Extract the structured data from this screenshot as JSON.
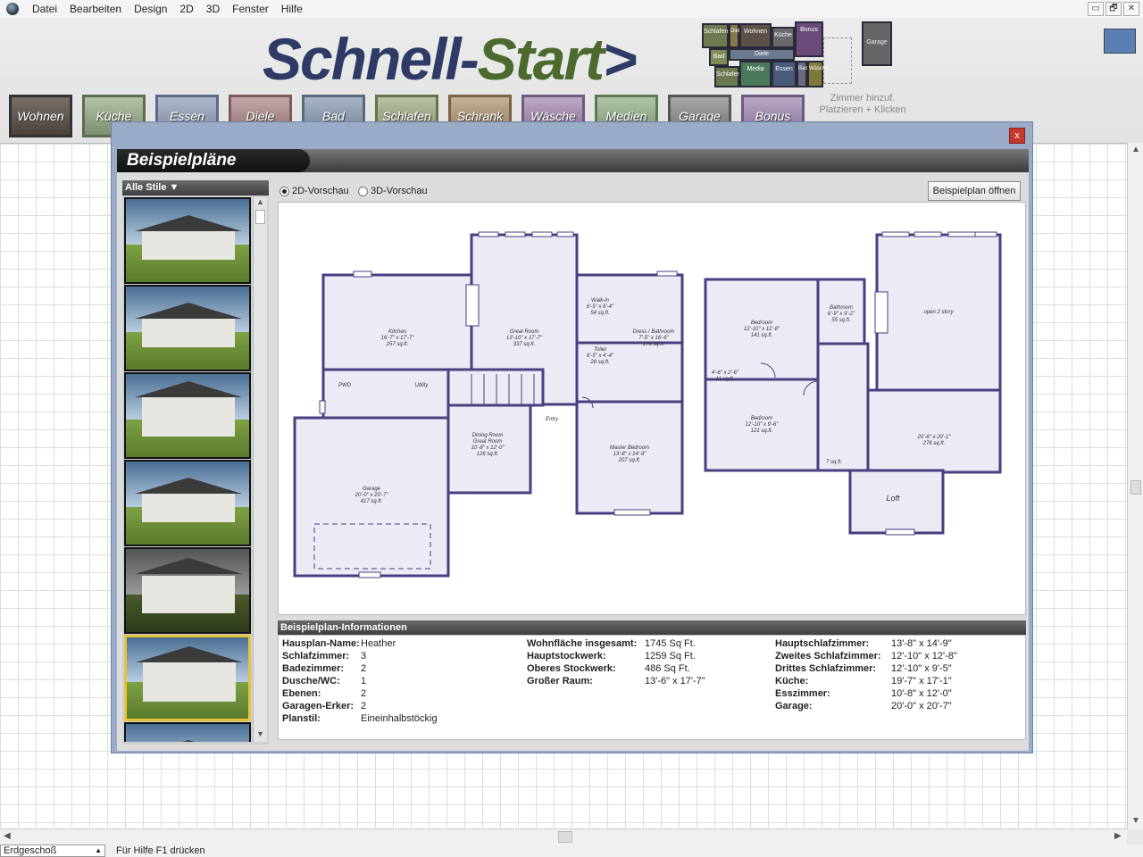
{
  "menu": [
    "Datei",
    "Bearbeiten",
    "Design",
    "2D",
    "3D",
    "Fenster",
    "Hilfe"
  ],
  "window_buttons": [
    "▭",
    "🗗",
    "✕"
  ],
  "banner": {
    "logo_part1": "Schnell-",
    "logo_part2": "Start",
    "logo_part3": ">",
    "mini_rooms": [
      "Schlafen",
      "Diele",
      "Wohnen",
      "Küche",
      "Bonus",
      "Bad",
      "Diele",
      "Schlafen",
      "Media",
      "Essen",
      "Bad",
      "Wäsche"
    ],
    "garage_label": "Garage",
    "hint_line1": "Zimmer hinzuf.",
    "hint_line2": "Platzieren + Klicken"
  },
  "room_buttons": [
    "Wohnen",
    "Küche",
    "Essen",
    "Diele",
    "Bad",
    "Schlafen",
    "Schrank",
    "Wäsche",
    "Medien",
    "Garage",
    "Bonus"
  ],
  "dialog": {
    "title": "Beispielpläne",
    "close": "x",
    "styles_label": "Alle Stile",
    "radio_2d": "2D-Vorschau",
    "radio_3d": "3D-Vorschau",
    "open_button": "Beispielplan öffnen",
    "info_title": "Beispielplan-Informationen",
    "plan_labels": {
      "kitchen": "Kitchen",
      "kitchen_dim": "16'-7\" x 17'-7\"",
      "kitchen_area": "257 sq.ft.",
      "great_room": "Great Room",
      "great_dim": "13'-10\" x 17'-7\"",
      "great_area": "337 sq.ft.",
      "walkin": "Walk-in",
      "walkin_dim": "6'-5\" x 6'-4\"",
      "walkin_area": "54 sq.ft.",
      "dress": "Dress / Bathroom",
      "dress_dim": "7'-5\" x 16'-6\"",
      "dress_area": "176 sq.ft.",
      "toilet": "Toilet",
      "toilet_dim": "6'-5\" x 4'-4\"",
      "toilet_area": "28 sq.ft.",
      "pwd": "PWD",
      "utility": "Utility",
      "entry": "Entry",
      "dining": "Dining Room",
      "dining2": "Great Room",
      "dining_dim": "10'-8\" x 12'-0\"",
      "dining_area": "126 sq.ft.",
      "garage": "Garage",
      "garage_dim": "20'-0\" x 20'-7\"",
      "garage_area": "417 sq.ft.",
      "master": "Master Bedroom",
      "master_dim": "13'-8\" x 14'-9\"",
      "master_area": "207 sq.ft.",
      "bed1": "Bedroom",
      "bed1_dim": "12'-10\" x 12'-8\"",
      "bed1_area": "141 sq.ft.",
      "bath": "Bathroom",
      "bath_dim": "6'-9\" x 9'-2\"",
      "bath_area": "55 sq.ft.",
      "open2": "open 2 story",
      "closet1": "4'-6\" x 2'-6\"",
      "closet1_area": "11 sq.ft.",
      "bed2": "Bedroom",
      "bed2_dim": "12'-10\" x 9'-6\"",
      "bed2_area": "121 sq.ft.",
      "loft_dim": "20'-6\" x 20'-1\"",
      "loft_area": "276 sq.ft.",
      "loft": "Loft",
      "small_area": "7 sq.ft."
    },
    "info_col1": [
      {
        "k": "Hausplan-Name:",
        "v": "Heather"
      },
      {
        "k": "Schlafzimmer:",
        "v": "3"
      },
      {
        "k": "Badezimmer:",
        "v": "2"
      },
      {
        "k": "Dusche/WC:",
        "v": "1"
      },
      {
        "k": "Ebenen:",
        "v": "2"
      },
      {
        "k": "Garagen-Erker:",
        "v": "2"
      },
      {
        "k": "Planstil:",
        "v": "Eineinhalbstöckig"
      }
    ],
    "info_col2": [
      {
        "k": "Wohnfläche insgesamt:",
        "v": "1745 Sq Ft."
      },
      {
        "k": "Hauptstockwerk:",
        "v": "1259 Sq Ft."
      },
      {
        "k": "Oberes Stockwerk:",
        "v": "486 Sq Ft."
      },
      {
        "k": "Großer Raum:",
        "v": "13'-6\" x 17'-7\""
      }
    ],
    "info_col3": [
      {
        "k": "Hauptschlafzimmer:",
        "v": "13'-8\" x 14'-9\""
      },
      {
        "k": "Zweites Schlafzimmer:",
        "v": "12'-10\" x 12'-8\""
      },
      {
        "k": "Drittes Schlafzimmer:",
        "v": "12'-10\" x 9'-5\""
      },
      {
        "k": "Küche:",
        "v": "19'-7\" x 17'-1\""
      },
      {
        "k": "Esszimmer:",
        "v": "10'-8\" x 12'-0\""
      },
      {
        "k": "Garage:",
        "v": "20'-0\" x 20'-7\""
      }
    ]
  },
  "status": {
    "floor": "Erdgeschoß",
    "help": "Für Hilfe F1 drücken"
  }
}
